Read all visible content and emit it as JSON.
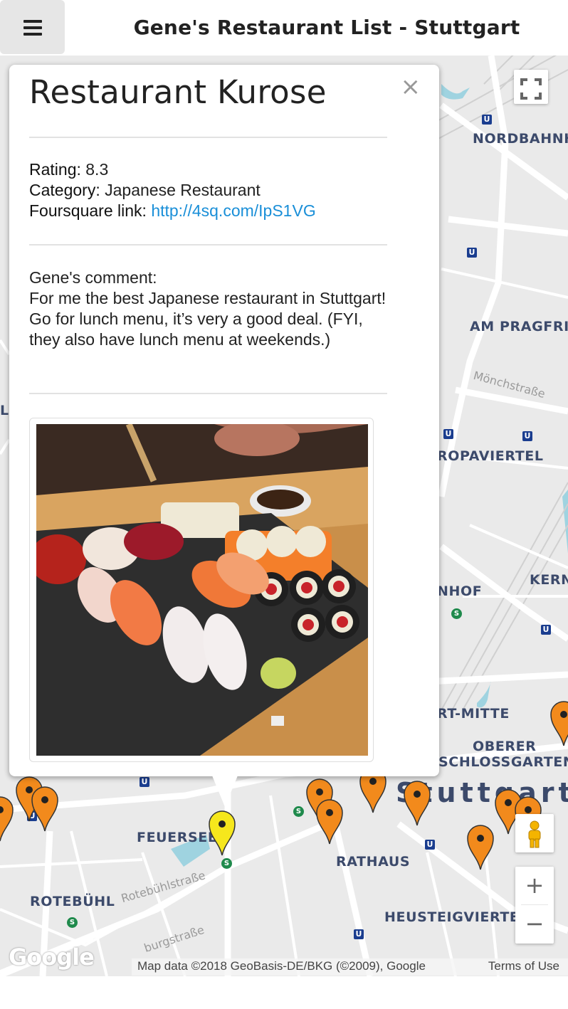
{
  "header": {
    "menu_icon": "hamburger-icon",
    "title": "Gene's Restaurant List - Stuttgart"
  },
  "infowindow": {
    "title": "Restaurant Kurose",
    "close_glyph": "×",
    "rating_label": "Rating:",
    "rating_value": "8.3",
    "category_label": "Category:",
    "category_value": "Japanese Restaurant",
    "foursquare_label": "Foursquare link:",
    "foursquare_link": "http://4sq.com/IpS1VG",
    "comment_label": "Gene's comment:",
    "comment_text": "For me the best Japanese restaurant in Stuttgart! Go for lunch menu, it’s very a good deal. (FYI, they also have lunch menu at weekends.)",
    "photo_icon": "sushi-photo"
  },
  "map": {
    "labels": {
      "nordbahnhof": "NORDBAHNH",
      "am_pragfriedhof": "AM PRAGFRI",
      "europaviertel": "ROPAVIERTEL",
      "kernerviertel": "KERN",
      "hauptbahnhof": "NHOF",
      "stuttgart_mitte": "RT-MITTE",
      "oberer_schlossgarten_1": "OBERER",
      "oberer_schlossgarten_2": "SCHLOSSGARTEN",
      "stuttgart": "Stuttgart",
      "feuersee": "FEUERSEE",
      "rathaus": "RATHAUS",
      "rotebuehl": "ROTEBÜHL",
      "heusteigviertel": "HEUSTEIGVIERTE",
      "left_partial": "LI"
    },
    "streets": {
      "moenchstrasse": "Mönchstraße",
      "rotebuehlstrasse": "Rotebühlstraße",
      "burgstrasse": "burgstraße"
    },
    "ubahn_glyph": "U",
    "sbahn_glyph": "S",
    "zoom_in": "+",
    "zoom_out": "−",
    "fullscreen_icon": "fullscreen-icon",
    "pegman_icon": "pegman-icon",
    "google_logo": "Google",
    "attribution": "Map data ©2018 GeoBasis-DE/BKG (©2009), Google",
    "terms": "Terms of Use",
    "colors": {
      "marker_default": "#f28a1c",
      "marker_selected": "#f6e71c",
      "link": "#1a8fd8"
    }
  }
}
